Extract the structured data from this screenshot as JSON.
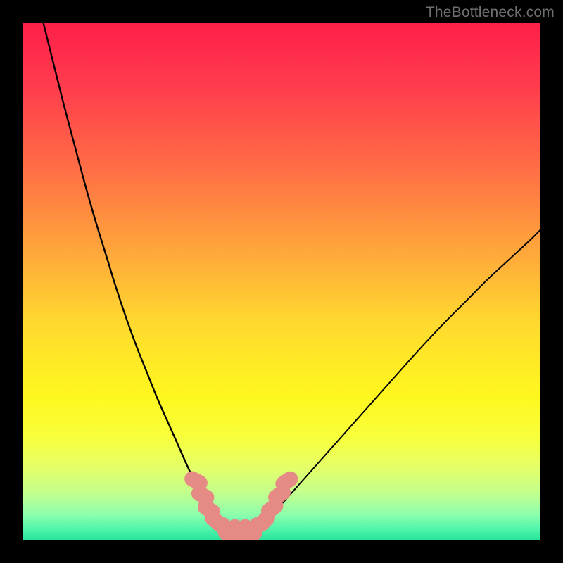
{
  "watermark": "TheBottleneck.com",
  "chart_data": {
    "type": "line",
    "title": "",
    "xlabel": "",
    "ylabel": "",
    "xlim": [
      0,
      100
    ],
    "ylim": [
      0,
      100
    ],
    "grid": false,
    "legend": false,
    "background_gradient": {
      "stops": [
        {
          "offset": 0.0,
          "color": "#ff1f4a"
        },
        {
          "offset": 0.12,
          "color": "#ff3b4d"
        },
        {
          "offset": 0.28,
          "color": "#ff6d45"
        },
        {
          "offset": 0.44,
          "color": "#ffa63b"
        },
        {
          "offset": 0.58,
          "color": "#ffd92e"
        },
        {
          "offset": 0.72,
          "color": "#fff71f"
        },
        {
          "offset": 0.8,
          "color": "#f7ff3a"
        },
        {
          "offset": 0.86,
          "color": "#e4ff69"
        },
        {
          "offset": 0.91,
          "color": "#c1ff8e"
        },
        {
          "offset": 0.95,
          "color": "#8dffad"
        },
        {
          "offset": 0.975,
          "color": "#55f7ac"
        },
        {
          "offset": 1.0,
          "color": "#26e39b"
        }
      ]
    },
    "series": [
      {
        "name": "left-curve",
        "color": "#000000",
        "stroke_width": 2.4,
        "x": [
          4,
          6,
          8,
          10,
          12,
          14,
          16,
          18,
          20,
          22,
          24,
          26,
          28,
          30,
          32,
          34,
          35.5,
          37
        ],
        "y": [
          100,
          92,
          84,
          76.5,
          69,
          62,
          55.5,
          49,
          43,
          37.5,
          32.5,
          27.5,
          23,
          18.5,
          14,
          10,
          7,
          4
        ]
      },
      {
        "name": "right-curve",
        "color": "#000000",
        "stroke_width": 2.0,
        "x": [
          47,
          50,
          54,
          58,
          62,
          66,
          70,
          74,
          78,
          82,
          86,
          90,
          94,
          98,
          100
        ],
        "y": [
          4,
          7,
          11.5,
          16,
          20.5,
          25,
          29.5,
          34,
          38.4,
          42.6,
          46.6,
          50.6,
          54.3,
          58,
          60
        ]
      }
    ],
    "markers": [
      {
        "name": "valley-markers",
        "color": "#e58a85",
        "size": 22,
        "shape": "rounded-rect",
        "points": [
          {
            "x": 33.5,
            "y": 11.5,
            "angle": -62
          },
          {
            "x": 34.8,
            "y": 8.7,
            "angle": -60
          },
          {
            "x": 36.0,
            "y": 6.0,
            "angle": -56
          },
          {
            "x": 37.3,
            "y": 3.8,
            "angle": -48
          },
          {
            "x": 39.0,
            "y": 2.2,
            "angle": -20
          },
          {
            "x": 41.0,
            "y": 1.8,
            "angle": 0
          },
          {
            "x": 43.0,
            "y": 1.8,
            "angle": 0
          },
          {
            "x": 45.0,
            "y": 2.2,
            "angle": 18
          },
          {
            "x": 46.7,
            "y": 3.8,
            "angle": 44
          },
          {
            "x": 48.2,
            "y": 6.2,
            "angle": 52
          },
          {
            "x": 49.6,
            "y": 8.8,
            "angle": 55
          },
          {
            "x": 51.0,
            "y": 11.4,
            "angle": 56
          }
        ]
      }
    ]
  }
}
